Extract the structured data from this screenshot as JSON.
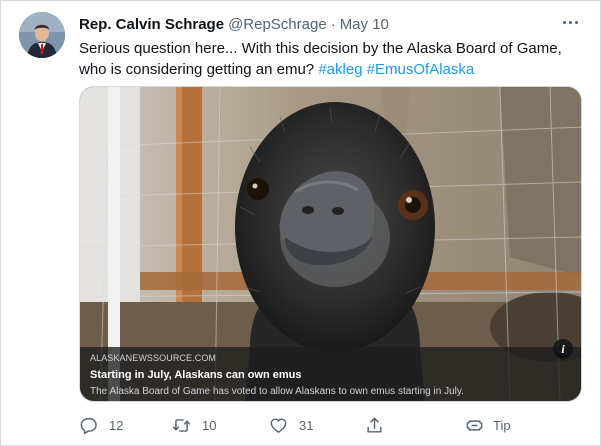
{
  "author": {
    "name": "Rep. Calvin Schrage",
    "handle": "@RepSchrage",
    "separator": "·",
    "date": "May 10"
  },
  "tweet": {
    "text": "Serious question here... With this decision by the Alaska Board of Game, who is considering getting an emu?",
    "hashtags": [
      "#akleg",
      "#EmusOfAlaska"
    ]
  },
  "card": {
    "domain": "ALASKANEWSSOURCE.COM",
    "title": "Starting in July, Alaskans can own emus",
    "description": "The Alaska Board of Game has voted to allow Alaskans to own emus starting in July.",
    "info_icon": "info-icon"
  },
  "actions": {
    "replies": "12",
    "retweets": "10",
    "likes": "31",
    "tip_label": "Tip"
  },
  "colors": {
    "accent": "#1d9bf0",
    "secondary_text": "#536471",
    "border": "#cfd9de"
  }
}
